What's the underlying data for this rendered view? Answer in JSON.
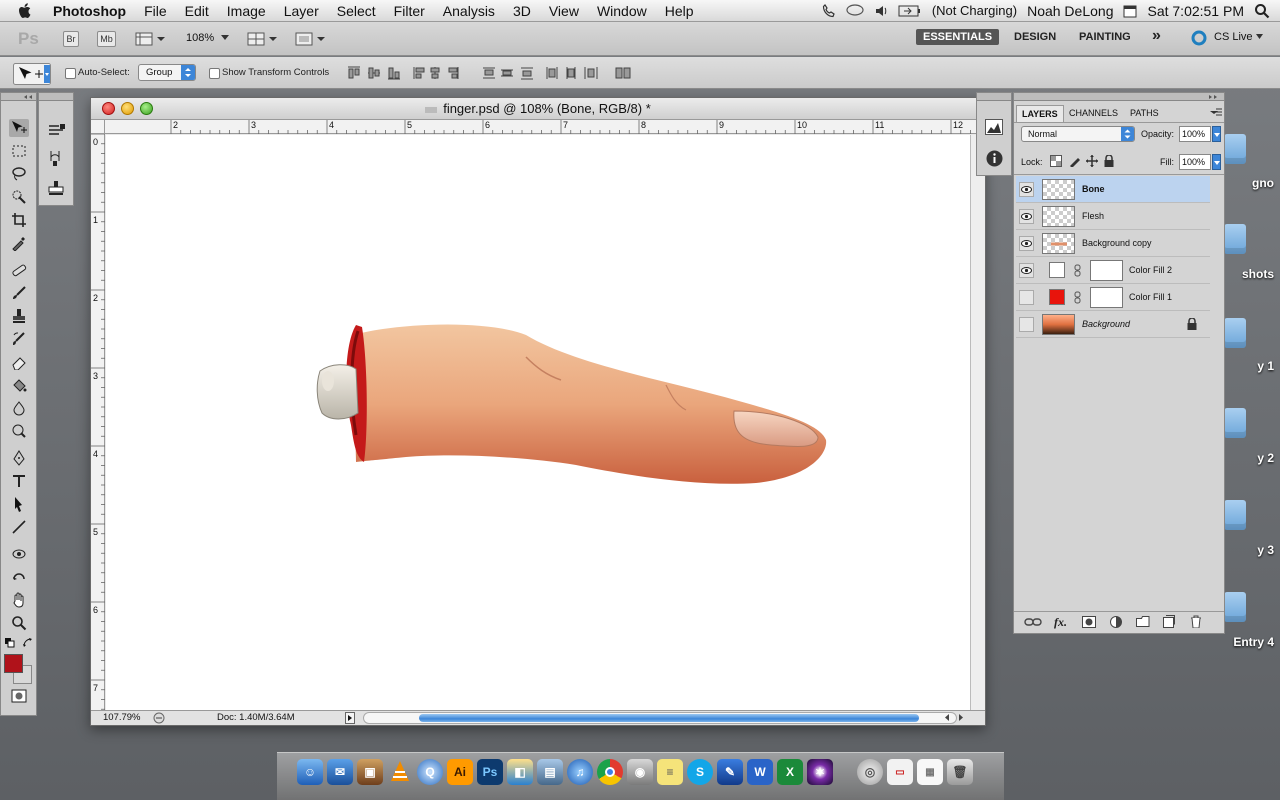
{
  "menubar": {
    "app_name": "Photoshop",
    "items": [
      "File",
      "Edit",
      "Image",
      "Layer",
      "Select",
      "Filter",
      "Analysis",
      "3D",
      "View",
      "Window",
      "Help"
    ],
    "battery_text": "(Not Charging)",
    "user": "Noah DeLong",
    "clock": "Sat 7:02:51 PM"
  },
  "appbar": {
    "logo": "Ps",
    "bridge": "Br",
    "minibridge": "Mb",
    "zoom": "108%",
    "workspaces": [
      "ESSENTIALS",
      "DESIGN",
      "PAINTING"
    ],
    "more": "»",
    "cslive": "CS Live"
  },
  "options": {
    "auto_select_label": "Auto-Select:",
    "auto_select_value": "Group",
    "show_transform_label": "Show Transform Controls"
  },
  "document": {
    "title": "finger.psd @ 108% (Bone, RGB/8) *",
    "ruler_top_numbers": [
      "2",
      "3",
      "4",
      "5",
      "6",
      "7",
      "8",
      "9",
      "10",
      "11",
      "12"
    ],
    "ruler_left_numbers": [
      "0",
      "1",
      "2",
      "3",
      "4",
      "5",
      "6",
      "7"
    ],
    "status_zoom": "107.79%",
    "status_doc": "Doc: 1.40M/3.64M"
  },
  "layers_panel": {
    "tabs": [
      "LAYERS",
      "CHANNELS",
      "PATHS"
    ],
    "blend_mode": "Normal",
    "opacity_label": "Opacity:",
    "opacity_value": "100%",
    "lock_label": "Lock:",
    "fill_label": "Fill:",
    "fill_value": "100%",
    "layers": [
      {
        "name": "Bone",
        "visible": true,
        "selected": true
      },
      {
        "name": "Flesh",
        "visible": true,
        "selected": false
      },
      {
        "name": "Background copy",
        "visible": true,
        "selected": false
      },
      {
        "name": "Color Fill 2",
        "visible": true,
        "selected": false,
        "fill_color": "#ffffff"
      },
      {
        "name": "Color Fill 1",
        "visible": false,
        "selected": false,
        "fill_color": "#e8140c"
      },
      {
        "name": "Background",
        "visible": false,
        "selected": false,
        "locked": true
      }
    ]
  },
  "desktop_labels": [
    "gno",
    "shots",
    "y 1",
    "y 2",
    "y 3",
    "Entry 4"
  ],
  "colors": {
    "foreground": "#b0121a",
    "accent_blue": "#3d86d8"
  }
}
